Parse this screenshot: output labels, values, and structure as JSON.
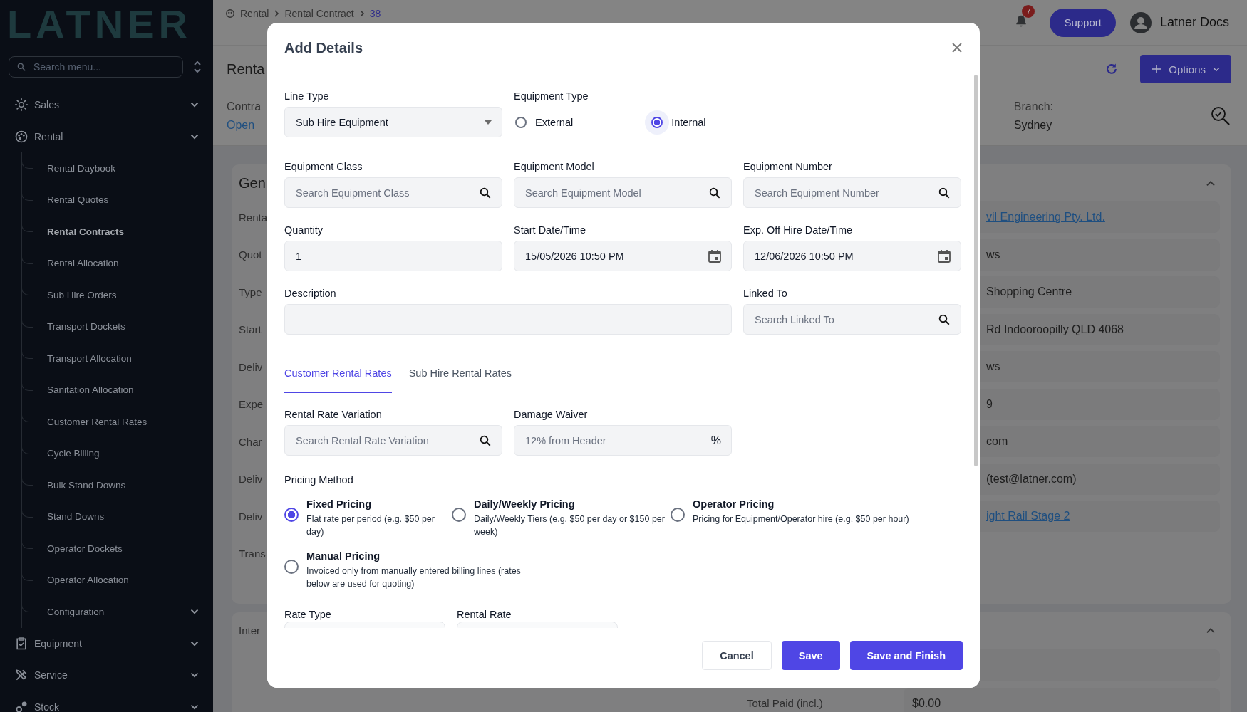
{
  "sidebar": {
    "logo": "LATNER",
    "search": {
      "placeholder": "Search menu..."
    },
    "items": [
      {
        "label": "Sales"
      },
      {
        "label": "Rental",
        "children": [
          {
            "label": "Rental Daybook",
            "selected": false,
            "expandable": false
          },
          {
            "label": "Rental Quotes",
            "selected": false,
            "expandable": false
          },
          {
            "label": "Rental Contracts",
            "selected": true,
            "expandable": false
          },
          {
            "label": "Rental Allocation",
            "selected": false,
            "expandable": false
          },
          {
            "label": "Sub Hire Orders",
            "selected": false,
            "expandable": false
          },
          {
            "label": "Transport Dockets",
            "selected": false,
            "expandable": false
          },
          {
            "label": "Transport Allocation",
            "selected": false,
            "expandable": false
          },
          {
            "label": "Sanitation Allocation",
            "selected": false,
            "expandable": false
          },
          {
            "label": "Customer Rental Rates",
            "selected": false,
            "expandable": false
          },
          {
            "label": "Cycle Billing",
            "selected": false,
            "expandable": false
          },
          {
            "label": "Bulk Stand Downs",
            "selected": false,
            "expandable": false
          },
          {
            "label": "Stand Downs",
            "selected": false,
            "expandable": false
          },
          {
            "label": "Operator Dockets",
            "selected": false,
            "expandable": false
          },
          {
            "label": "Operator Allocation",
            "selected": false,
            "expandable": false
          },
          {
            "label": "Configuration",
            "selected": false,
            "expandable": true
          }
        ]
      },
      {
        "label": "Equipment"
      },
      {
        "label": "Service"
      },
      {
        "label": "Stock"
      }
    ]
  },
  "header": {
    "breadcrumb": [
      {
        "label": "Rental",
        "current": false
      },
      {
        "label": "Rental Contract",
        "current": false
      },
      {
        "label": "38",
        "current": true
      }
    ],
    "notifications": "7",
    "support": "Support",
    "user": "Latner Docs"
  },
  "page": {
    "title": "Renta",
    "options_button": "Options",
    "status": {
      "label": "Contra",
      "value": "Open"
    },
    "branch": {
      "label": "Branch:",
      "value": "Sydney"
    },
    "general": {
      "heading": "Gen",
      "rows": [
        {
          "label": "Renta",
          "value": "vil Engineering Pty. Ltd.",
          "kind": "link"
        },
        {
          "label": "Quot",
          "value": "ws",
          "kind": "text"
        },
        {
          "label": "Type",
          "value": "Shopping Centre",
          "kind": "text"
        },
        {
          "label": "Start",
          "value": "Rd Indooroopilly QLD 4068",
          "kind": "text"
        },
        {
          "label": "Deliv",
          "value": "ws",
          "kind": "text"
        },
        {
          "label": "Expe",
          "value": "9",
          "kind": "text"
        },
        {
          "label": "Char",
          "value": "com",
          "kind": "text"
        },
        {
          "label": "Deliv",
          "value": "(test@latner.com)",
          "kind": "text"
        },
        {
          "label": "Deliv",
          "value": "ight Rail Stage 2",
          "kind": "link"
        },
        {
          "label": "Trans",
          "kind": "none"
        }
      ]
    },
    "totals": {
      "heading": "Inter",
      "rows": [
        {
          "label": "Total Paid (incl.)",
          "value": "$0.00"
        }
      ]
    }
  },
  "modal": {
    "title": "Add Details",
    "line_type": {
      "label": "Line Type",
      "value": "Sub Hire Equipment"
    },
    "equipment_type": {
      "label": "Equipment Type",
      "options": [
        {
          "label": "External",
          "selected": false
        },
        {
          "label": "Internal",
          "selected": true
        }
      ]
    },
    "fields": [
      {
        "label": "Equipment Class",
        "kind": "search",
        "placeholder": "Search Equipment Class",
        "wide": false
      },
      {
        "label": "Equipment Model",
        "kind": "search",
        "placeholder": "Search Equipment Model",
        "wide": false
      },
      {
        "label": "Equipment Number",
        "kind": "search",
        "placeholder": "Search Equipment Number",
        "wide": false
      },
      {
        "label": "Quantity",
        "kind": "text",
        "value": "1",
        "wide": false
      },
      {
        "label": "Start Date/Time",
        "kind": "date",
        "value": "15/05/2026 10:50 PM",
        "wide": false
      },
      {
        "label": "Exp. Off Hire Date/Time",
        "kind": "date",
        "value": "12/06/2026 10:50 PM",
        "wide": false
      },
      {
        "label": "Description",
        "kind": "text",
        "wide": true
      },
      {
        "label": "Linked To",
        "kind": "search",
        "placeholder": "Search Linked To",
        "wide": false
      }
    ],
    "tabs": [
      {
        "label": "Customer Rental Rates",
        "selected": true
      },
      {
        "label": "Sub Hire Rental Rates",
        "selected": false
      }
    ],
    "rate_fields": [
      {
        "label": "Rental Rate Variation",
        "kind": "search",
        "placeholder": "Search Rental Rate Variation"
      },
      {
        "label": "Damage Waiver",
        "kind": "percent",
        "placeholder": "12% from Header",
        "suffix": "%"
      }
    ],
    "pricing_method": {
      "label": "Pricing Method",
      "options": [
        {
          "title": "Fixed Pricing",
          "description": "Flat rate per period (e.g. $50 per day)",
          "selected": true
        },
        {
          "title": "Daily/Weekly Pricing",
          "description": "Daily/Weekly Tiers (e.g. $50 per day or $150 per week)",
          "selected": false
        },
        {
          "title": "Operator Pricing",
          "description": "Pricing for Equipment/Operator hire (e.g. $50 per hour)",
          "selected": false
        },
        {
          "title": "Manual Pricing",
          "description": "Invoiced only from manually entered billing lines (rates below are used for quoting)",
          "selected": false
        }
      ]
    },
    "rate_row": [
      {
        "label": "Rate Type"
      },
      {
        "label": "Rental Rate"
      }
    ],
    "buttons": [
      {
        "label": "Cancel",
        "kind": "secondary"
      },
      {
        "label": "Save",
        "kind": "primary"
      },
      {
        "label": "Save and Finish",
        "kind": "primary"
      }
    ]
  }
}
